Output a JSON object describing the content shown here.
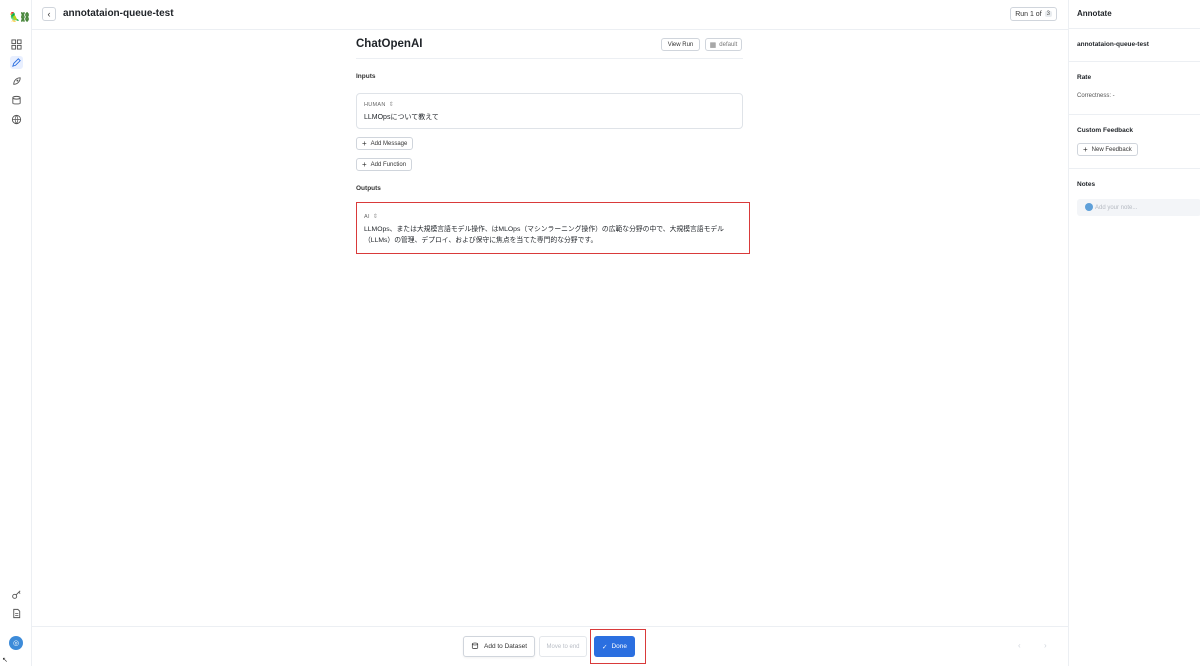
{
  "app": {
    "logo": "🦜⛓"
  },
  "header": {
    "title": "annotataion-queue-test",
    "run_counter": {
      "label": "Run 1 of",
      "total": "3"
    }
  },
  "run": {
    "name": "ChatOpenAI",
    "view_run_label": "View Run",
    "tag_label": "default"
  },
  "inputs": {
    "section_label": "Inputs",
    "messages": [
      {
        "role": "HUMAN",
        "text": "LLMOpsについて教えて"
      }
    ],
    "add_message_label": "Add Message",
    "add_function_label": "Add Function"
  },
  "outputs": {
    "section_label": "Outputs",
    "role": "AI",
    "text": "LLMOps、または大規模言語モデル操作、はMLOps（マシンラーニング操作）の広範な分野の中で、大規模言語モデル（LLMs）の管理、デプロイ、および保守に焦点を当てた専門的な分野です。"
  },
  "annotate_panel": {
    "title": "Annotate",
    "queue_name": "annotataion-queue-test",
    "rate_label": "Rate",
    "correctness": "Correctness: -",
    "custom_feedback_label": "Custom Feedback",
    "new_feedback_label": "New Feedback",
    "notes_label": "Notes",
    "notes_placeholder": "Add your note..."
  },
  "footer": {
    "add_to_dataset_label": "Add to Dataset",
    "move_to_end_label": "Move to end",
    "done_label": "Done"
  },
  "colors": {
    "accent": "#2b6fe0",
    "highlight": "#d93a3a"
  }
}
